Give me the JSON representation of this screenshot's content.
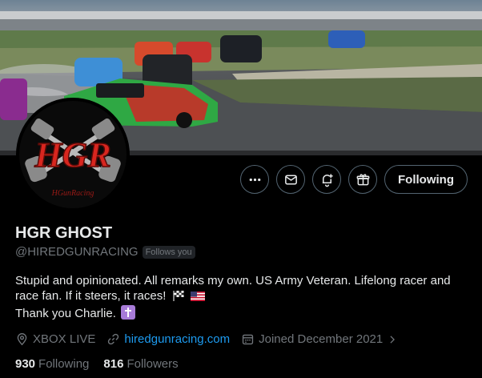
{
  "profile": {
    "display_name": "HGR GHOST",
    "handle": "@HIREDGUNRACING",
    "follows_you_badge": "Follows you",
    "bio_line1": "Stupid and opinionated. All remarks my own. US Army Veteran. Lifelong racer and race fan. If it steers, it races!",
    "bio_line2": "Thank you Charlie.",
    "location": "XBOX LIVE",
    "website": "hiredgunracing.com",
    "joined": "Joined December 2021"
  },
  "avatar": {
    "monogram": "HGR",
    "tagline": "HGunRacing"
  },
  "actions": {
    "more_icon": "more-icon",
    "message_icon": "envelope-icon",
    "notify_icon": "bell-plus-icon",
    "gift_icon": "gift-icon",
    "following_label": "Following"
  },
  "stats": {
    "following_count": "930",
    "following_label": "Following",
    "followers_count": "816",
    "followers_label": "Followers"
  },
  "colors": {
    "background": "#000000",
    "text_primary": "#e7e9ea",
    "text_secondary": "#71767b",
    "link": "#1d9bf0",
    "button_border": "#536471",
    "cross_emoji_bg": "#a77bd8"
  }
}
